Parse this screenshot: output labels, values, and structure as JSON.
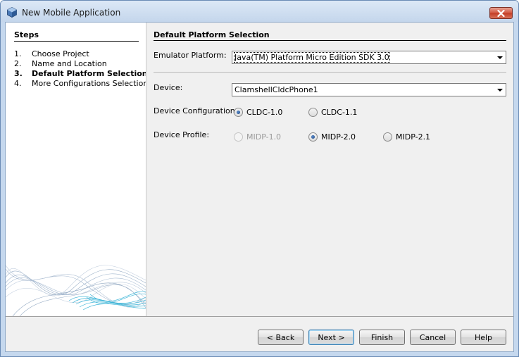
{
  "window": {
    "title": "New Mobile Application"
  },
  "steps": {
    "title": "Steps",
    "items": [
      {
        "num": "1.",
        "label": "Choose Project"
      },
      {
        "num": "2.",
        "label": "Name and Location"
      },
      {
        "num": "3.",
        "label": "Default Platform Selection"
      },
      {
        "num": "4.",
        "label": "More Configurations Selection"
      }
    ],
    "current_index": 2
  },
  "content": {
    "title": "Default Platform Selection",
    "emulator_platform": {
      "label": "Emulator Platform:",
      "value": "Java(TM) Platform Micro Edition SDK 3.0"
    },
    "device": {
      "label": "Device:",
      "value": "ClamshellCldcPhone1"
    },
    "device_configuration": {
      "label": "Device Configuration:",
      "options": [
        {
          "label": "CLDC-1.0",
          "checked": true,
          "enabled": true
        },
        {
          "label": "CLDC-1.1",
          "checked": false,
          "enabled": true
        }
      ]
    },
    "device_profile": {
      "label": "Device Profile:",
      "options": [
        {
          "label": "MIDP-1.0",
          "checked": false,
          "enabled": false
        },
        {
          "label": "MIDP-2.0",
          "checked": true,
          "enabled": true
        },
        {
          "label": "MIDP-2.1",
          "checked": false,
          "enabled": true
        }
      ]
    }
  },
  "buttons": {
    "back": "< Back",
    "next": "Next >",
    "finish": "Finish",
    "cancel": "Cancel",
    "help": "Help"
  },
  "colors": {
    "titlebar": "#c4d6ec",
    "close_button": "#c23b24",
    "dialog_bg": "#f0f0f0",
    "wave_accent": "#3fb6d8"
  },
  "icons": {
    "app": "netbeans-cube-icon",
    "close": "close-icon",
    "dropdown": "chevron-down-icon"
  }
}
